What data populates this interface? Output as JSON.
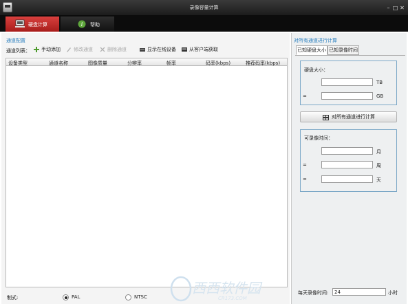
{
  "window": {
    "title": "录像容量计算"
  },
  "tabs": [
    {
      "label": "硬盘计算"
    },
    {
      "label": "帮助"
    }
  ],
  "left": {
    "section_title": "通道配置",
    "channel_list_label": "通道列表：",
    "toolbar": {
      "add": "手动添加",
      "edit": "修改通道",
      "delete": "删除通道",
      "online": "显示在线设备",
      "client": "从客户端获取"
    },
    "table_columns": [
      "设备类型",
      "通道名称",
      "图像质量",
      "分辨率",
      "帧率",
      "码率(kbps)",
      "推荐码率(kbps)"
    ],
    "format_label": "制式:",
    "format_options": [
      "PAL",
      "NTSC"
    ],
    "format_selected": "PAL"
  },
  "right": {
    "section_title": "对所有通道进行计算",
    "tabs": [
      "已知硬盘大小",
      "已知录像时间"
    ],
    "disk_group": {
      "title": "硬盘大小：",
      "rows": [
        {
          "prefix": "",
          "value": "",
          "unit": "TB"
        },
        {
          "prefix": "=",
          "value": "",
          "unit": "GB"
        }
      ]
    },
    "calc_button": "对所有通道进行计算",
    "time_group": {
      "title": "可录像时间：",
      "rows": [
        {
          "prefix": "",
          "value": "",
          "unit": "月"
        },
        {
          "prefix": "=",
          "value": "",
          "unit": "周"
        },
        {
          "prefix": "=",
          "value": "",
          "unit": "天"
        }
      ]
    },
    "daily_hours_label": "每天录像时间:",
    "daily_hours_value": "24",
    "daily_hours_unit": "小时"
  },
  "watermark": {
    "text": "西西软件园",
    "subtext": "CR173.COM"
  },
  "colors": {
    "accent_red": "#c8302e",
    "section_blue": "#2a7fbf",
    "groupbox_border": "#7ba7c7"
  }
}
